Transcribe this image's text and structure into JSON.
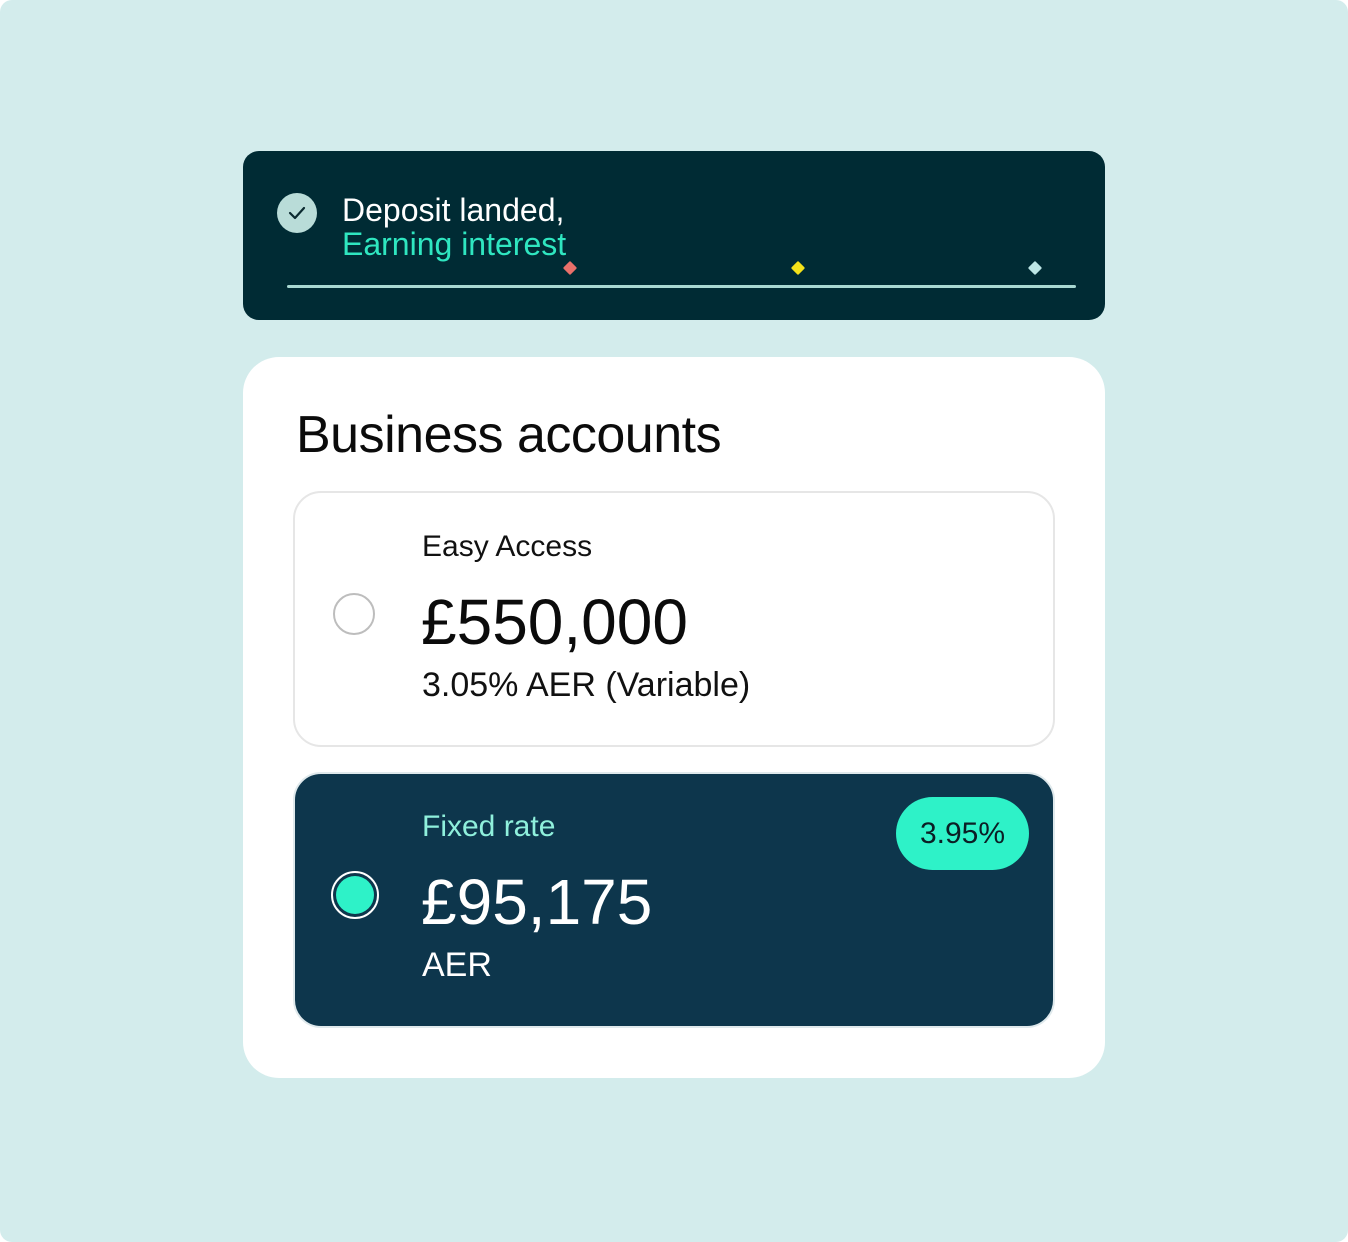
{
  "notification": {
    "line1": "Deposit landed,",
    "line2": "Earning interest",
    "icon": "check-icon"
  },
  "accounts": {
    "title": "Business accounts",
    "options": [
      {
        "label": "Easy Access",
        "amount": "£550,000",
        "rate_text": "3.05% AER (Variable)",
        "selected": false
      },
      {
        "label": "Fixed rate",
        "amount": "£95,175",
        "rate_text": "AER",
        "badge": "3.95%",
        "selected": true
      }
    ]
  },
  "colors": {
    "background": "#d3ecec",
    "banner": "#002b34",
    "accent": "#2ef2c8",
    "selected_card": "#0d364c"
  }
}
